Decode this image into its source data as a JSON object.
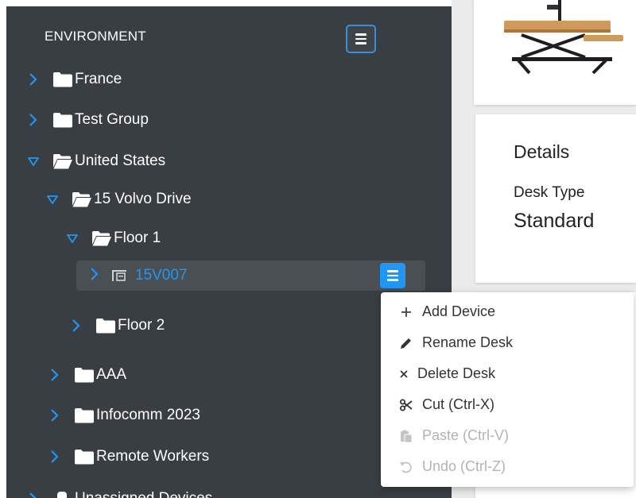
{
  "sidebar": {
    "title": "ENVIRONMENT",
    "tree": {
      "france": "France",
      "test_group": "Test Group",
      "united_states": "United States",
      "volvo_drive": "15 Volvo Drive",
      "floor1": "Floor 1",
      "desk": "15V007",
      "floor2": "Floor 2",
      "aaa": "AAA",
      "infocomm": "Infocomm 2023",
      "remote_workers": "Remote Workers",
      "unassigned": "Unassigned Devices"
    }
  },
  "details": {
    "title": "Details",
    "desk_type_label": "Desk Type",
    "desk_type_value": "Standard"
  },
  "context_menu": {
    "items": [
      {
        "label": "Add Device",
        "icon": "plus-icon",
        "enabled": true
      },
      {
        "label": "Rename Desk",
        "icon": "pencil-icon",
        "enabled": true
      },
      {
        "label": "Delete Desk",
        "icon": "x-icon",
        "enabled": true
      },
      {
        "label": "Cut (Ctrl-X)",
        "icon": "scissors-icon",
        "enabled": true
      },
      {
        "label": "Paste (Ctrl-V)",
        "icon": "paste-icon",
        "enabled": false
      },
      {
        "label": "Undo (Ctrl-Z)",
        "icon": "undo-icon",
        "enabled": false
      }
    ]
  },
  "colors": {
    "sidebar_bg": "#393e43",
    "accent": "#2196f3",
    "selected_row_bg": "#4a4f54"
  }
}
